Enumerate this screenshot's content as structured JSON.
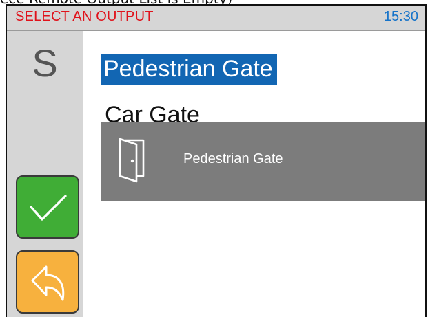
{
  "caption": "ece Remote Output List is Empty)",
  "header": {
    "title": "SELECT AN OUTPUT",
    "time": "15:30"
  },
  "sidebar": {
    "letter": "S",
    "confirm_icon": "checkmark-icon",
    "back_icon": "back-arrow-icon"
  },
  "outputs": [
    {
      "label": "Pedestrian Gate",
      "selected": true
    },
    {
      "label": "Car Gate",
      "selected": false
    }
  ],
  "toast": {
    "icon": "door-icon",
    "label": "Pedestrian Gate"
  },
  "colors": {
    "title": "#e0121b",
    "time": "#1673c9",
    "selection": "#1266b3",
    "confirm": "#40ad36",
    "back": "#f7b13e",
    "toast": "#7c7c7c",
    "panel": "#d6d6d6"
  }
}
